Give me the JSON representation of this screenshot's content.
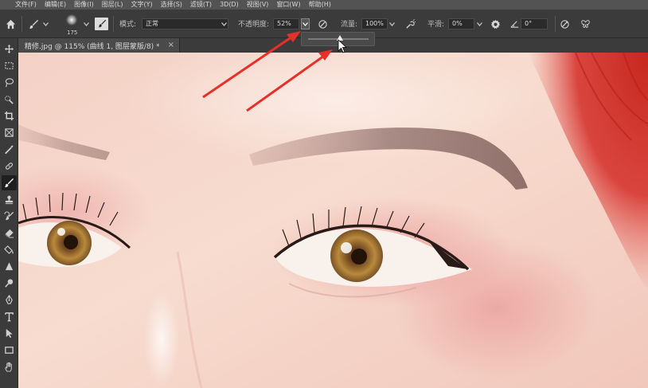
{
  "menu": [
    "文件(F)",
    "编辑(E)",
    "图像(I)",
    "图层(L)",
    "文字(Y)",
    "选择(S)",
    "滤镜(T)",
    "3D(D)",
    "视图(V)",
    "窗口(W)",
    "帮助(H)"
  ],
  "options": {
    "brush_size": "175",
    "mode_label": "模式:",
    "mode_value": "正常",
    "opacity_label": "不透明度:",
    "opacity_value": "52%",
    "flow_label": "流量:",
    "flow_value": "100%",
    "smoothing_label": "平滑:",
    "smoothing_value": "0%",
    "angle_value": "0°"
  },
  "opacity_slider": {
    "value": 0.52
  },
  "document_tab": {
    "label": "精修.jpg @ 115% (曲线 1, 图层蒙版/8) *",
    "close": "×"
  },
  "icons": {
    "home": "home-icon",
    "brush_tool": "brush-icon",
    "brush_panel": "brush-settings-icon",
    "pressure_opacity": "pressure-opacity-icon",
    "airbrush": "airbrush-icon",
    "settings": "gear-icon",
    "angle": "angle-icon",
    "pressure_size": "pressure-size-icon",
    "symmetry": "symmetry-butterfly-icon"
  },
  "colors": {
    "annotation_arrow": "#e8302a",
    "ui_dark": "#3b3b3b",
    "menubar": "#535353"
  }
}
